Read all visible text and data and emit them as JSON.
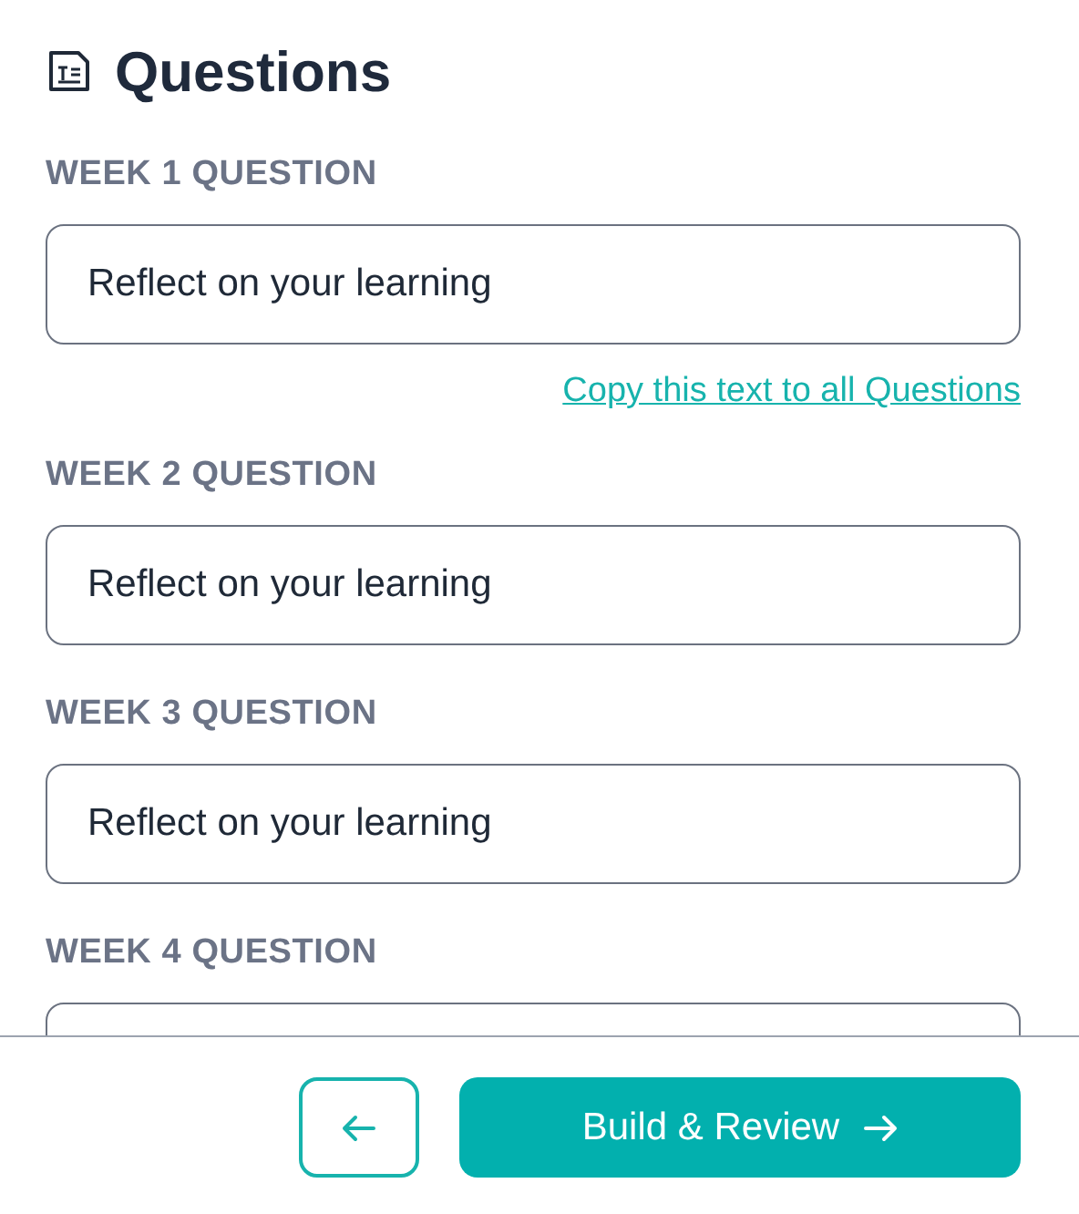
{
  "title": "Questions",
  "questions": [
    {
      "label": "WEEK 1 QUESTION",
      "value": "Reflect on your learning",
      "link": "Copy this text to all Questions"
    },
    {
      "label": "WEEK 2 QUESTION",
      "value": "Reflect on your learning"
    },
    {
      "label": "WEEK 3 QUESTION",
      "value": "Reflect on your learning"
    },
    {
      "label": "WEEK 4 QUESTION"
    }
  ],
  "footer": {
    "primary_button": "Build & Review"
  }
}
